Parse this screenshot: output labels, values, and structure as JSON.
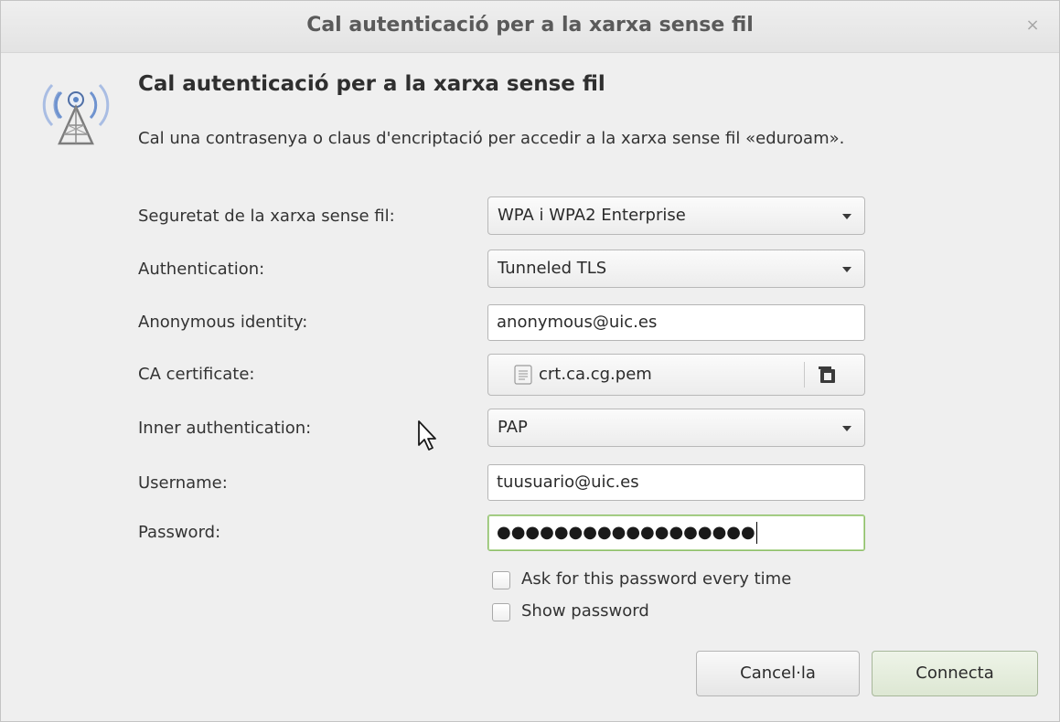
{
  "window": {
    "title": "Cal autenticació per a la xarxa sense fil",
    "close_glyph": "×"
  },
  "header": {
    "icon": "wireless-tower-icon",
    "heading": "Cal autenticació per a la xarxa sense fil",
    "description": "Cal una contrasenya o claus d'encriptació per accedir a la xarxa sense fil «eduroam»."
  },
  "form": {
    "security": {
      "label": "Seguretat de la xarxa sense fil:",
      "value": "WPA i WPA2 Enterprise"
    },
    "authentication": {
      "label": "Authentication:",
      "value": "Tunneled TLS"
    },
    "anonymous_identity": {
      "label": "Anonymous identity:",
      "value": "anonymous@uic.es"
    },
    "ca_certificate": {
      "label": "CA certificate:",
      "file": "crt.ca.cg.pem",
      "file_icon": "document-icon",
      "open_icon": "open-file-icon"
    },
    "inner_authentication": {
      "label": "Inner authentication:",
      "value": "PAP"
    },
    "username": {
      "label": "Username:",
      "value": "tuusuario@uic.es"
    },
    "password": {
      "label": "Password:",
      "masked_value": "●●●●●●●●●●●●●●●●●●"
    },
    "ask_password": {
      "label": "Ask for this password every time",
      "checked": false
    },
    "show_password": {
      "label": "Show password",
      "checked": false
    }
  },
  "buttons": {
    "cancel": "Cancel·la",
    "connect": "Connecta"
  },
  "colors": {
    "focus_border": "#8fbf6a",
    "icon_blue": "#5b84c4"
  }
}
